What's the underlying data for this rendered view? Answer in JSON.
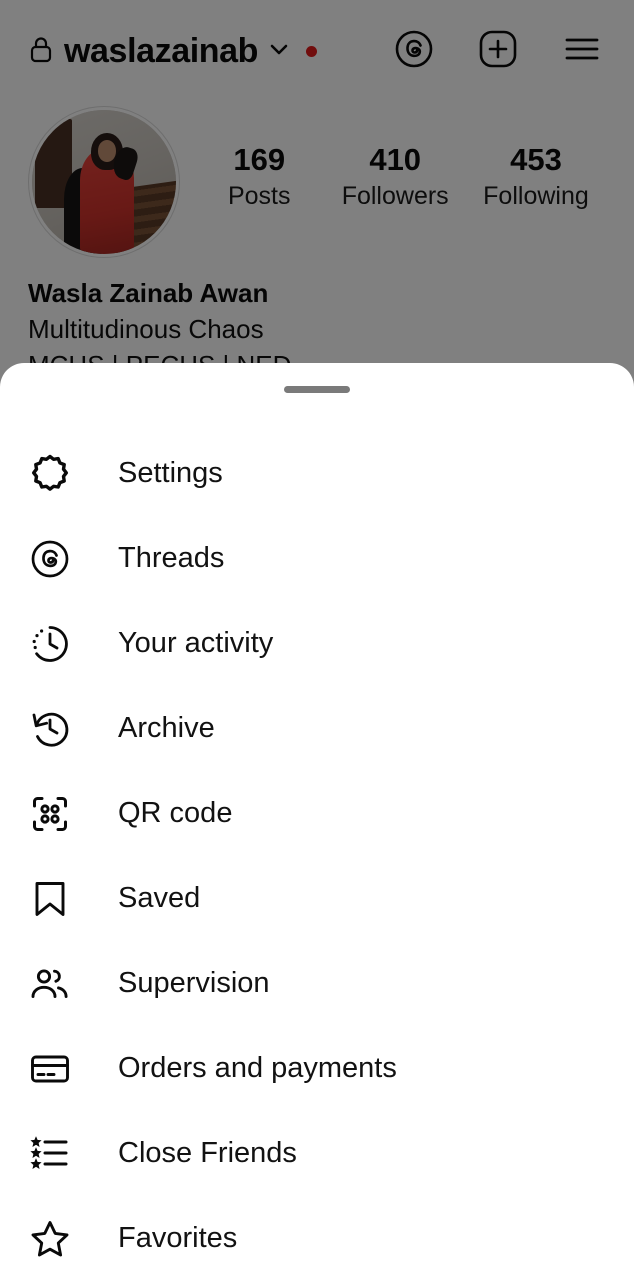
{
  "header": {
    "lock_icon": "lock-icon",
    "username": "waslazainab",
    "chevron_icon": "chevron-down-icon",
    "has_notification_dot": true,
    "notification_dot_color": "#e21b1b",
    "actions": [
      {
        "name": "threads-icon",
        "label": "Threads"
      },
      {
        "name": "new-post-icon",
        "label": "New post"
      },
      {
        "name": "hamburger-menu-icon",
        "label": "Menu"
      }
    ]
  },
  "profile": {
    "avatar_name": "profile-avatar",
    "stats": [
      {
        "value": "169",
        "label": "Posts"
      },
      {
        "value": "410",
        "label": "Followers"
      },
      {
        "value": "453",
        "label": "Following"
      }
    ],
    "bio": {
      "name": "Wasla Zainab Awan",
      "line1": "Multitudinous Chaos",
      "line2": "MCHS | PECHS | NED"
    }
  },
  "sheet": {
    "drag_handle": "sheet-drag-handle",
    "menu_items": [
      {
        "label": "Settings",
        "icon": "gear-icon"
      },
      {
        "label": "Threads",
        "icon": "threads-icon"
      },
      {
        "label": "Your activity",
        "icon": "activity-clock-icon"
      },
      {
        "label": "Archive",
        "icon": "archive-clock-icon"
      },
      {
        "label": "QR code",
        "icon": "qr-code-icon"
      },
      {
        "label": "Saved",
        "icon": "bookmark-icon"
      },
      {
        "label": "Supervision",
        "icon": "people-icon"
      },
      {
        "label": "Orders and payments",
        "icon": "credit-card-icon"
      },
      {
        "label": "Close Friends",
        "icon": "star-list-icon"
      },
      {
        "label": "Favorites",
        "icon": "star-icon"
      }
    ]
  },
  "colors": {
    "text_primary": "#121212",
    "sheet_background": "#ffffff",
    "scrim": "rgba(0,0,0,0.5)",
    "notification_red": "#e21b1b"
  }
}
